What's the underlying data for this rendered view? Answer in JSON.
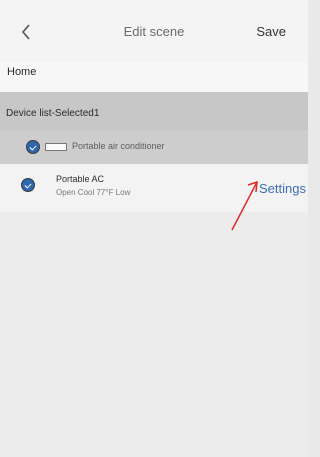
{
  "header": {
    "back_icon": "chevron-left-icon",
    "title": "Edit scene",
    "save_label": "Save"
  },
  "home_label": "Home",
  "device_list": {
    "header": "Device list-Selected1",
    "items": [
      {
        "label": "Portable air conditioner",
        "icon": "device-placeholder-icon",
        "selected": true
      },
      {
        "name": "Portable  AC",
        "status": "Open Cool 77°F Low",
        "action_label": "Settings",
        "selected": true
      }
    ]
  },
  "annotation": {
    "color": "#e02a2a",
    "icon": "red-pointer-arrow"
  },
  "colors": {
    "accent": "#3e6fb4",
    "checkbox": "#2f66b0"
  }
}
